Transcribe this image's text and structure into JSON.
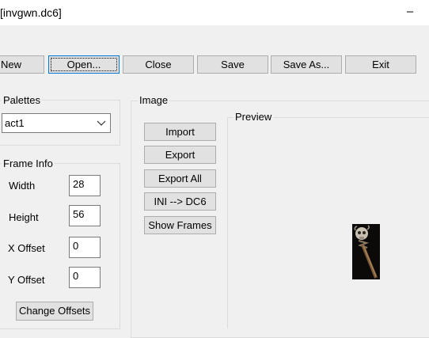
{
  "window": {
    "title": "[invgwn.dc6]",
    "minimize_glyph": "–"
  },
  "toolbar": {
    "new": "New",
    "open": "Open...",
    "close": "Close",
    "save": "Save",
    "save_as": "Save As...",
    "exit": "Exit"
  },
  "palettes": {
    "legend": "Palettes",
    "selected": "act1"
  },
  "frame_info": {
    "legend": "Frame Info",
    "width_label": "Width",
    "width_value": "28",
    "height_label": "Height",
    "height_value": "56",
    "xoffset_label": "X Offset",
    "xoffset_value": "0",
    "yoffset_label": "Y Offset",
    "yoffset_value": "0",
    "change_offsets": "Change Offsets"
  },
  "image": {
    "legend": "Image",
    "import": "Import",
    "export": "Export",
    "export_all": "Export All",
    "ini_to_dc6": "INI --> DC6",
    "show_frames": "Show Frames"
  },
  "preview": {
    "legend": "Preview"
  },
  "icons": {
    "dropdown": "chevron-down-icon",
    "sprite": "staff-sprite-image"
  },
  "colors": {
    "focus_border": "#0078d7",
    "button_face": "#e1e1e1",
    "window_bg": "#f0f0f0"
  }
}
